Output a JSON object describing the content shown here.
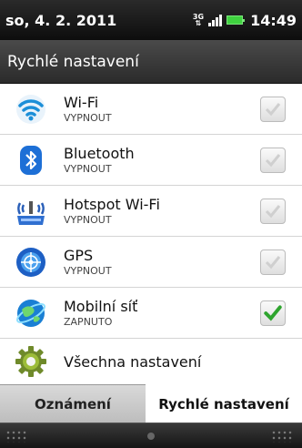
{
  "status": {
    "date": "so, 4. 2. 2011",
    "network": "3G",
    "time": "14:49"
  },
  "header": {
    "title": "Rychlé nastavení"
  },
  "settings": [
    {
      "label": "Wi-Fi",
      "status": "VYPNOUT",
      "checked": false,
      "icon": "wifi-icon"
    },
    {
      "label": "Bluetooth",
      "status": "VYPNOUT",
      "checked": false,
      "icon": "bluetooth-icon"
    },
    {
      "label": "Hotspot Wi-Fi",
      "status": "VYPNOUT",
      "checked": false,
      "icon": "hotspot-icon"
    },
    {
      "label": "GPS",
      "status": "VYPNOUT",
      "checked": false,
      "icon": "gps-icon"
    },
    {
      "label": "Mobilní síť",
      "status": "ZAPNUTO",
      "checked": true,
      "icon": "mobile-network-icon"
    }
  ],
  "all_settings": {
    "label": "Všechna nastavení",
    "icon": "gear-icon"
  },
  "tabs": [
    {
      "label": "Oznámení",
      "selected": false
    },
    {
      "label": "Rychlé nastavení",
      "selected": true
    }
  ]
}
